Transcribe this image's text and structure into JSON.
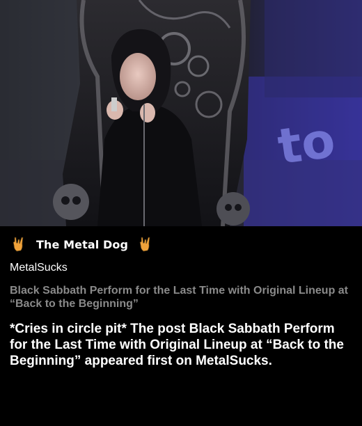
{
  "hero": {
    "image": "concert-screen-photo",
    "screen_text": "to"
  },
  "feed": {
    "title": "The Metal Dog",
    "icon_left": "rock-horns-hand-icon",
    "icon_right": "rock-horns-hand-icon",
    "icon_color": "#f0a23a"
  },
  "post": {
    "source": "MetalSucks",
    "title": "Black Sabbath Perform for the Last Time with Original Lineup at “Back to the Beginning”",
    "body": "*Cries in circle pit* The post Black Sabbath Perform for the Last Time with Original Lineup at “Back to the Beginning” appeared first on MetalSucks."
  }
}
